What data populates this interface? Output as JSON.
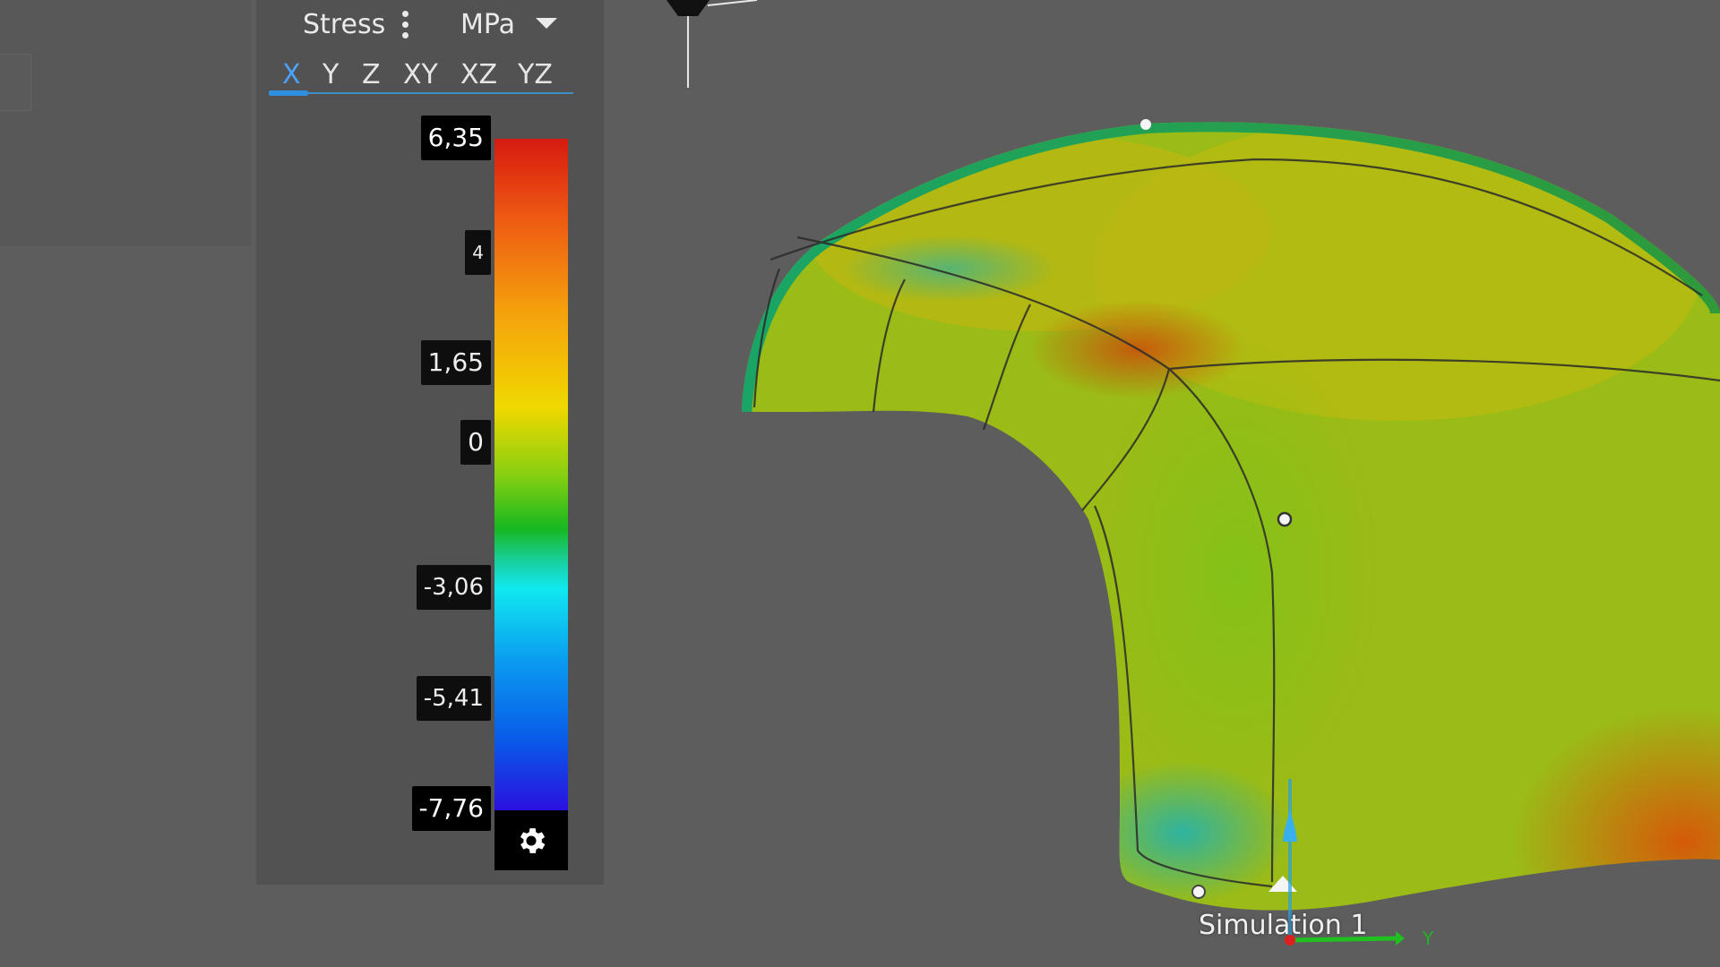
{
  "legend": {
    "result_type": "Stress",
    "unit": "MPa",
    "tabs": [
      {
        "label": "X",
        "active": true
      },
      {
        "label": "Y",
        "active": false
      },
      {
        "label": "Z",
        "active": false
      },
      {
        "label": "XY",
        "active": false
      },
      {
        "label": "XZ",
        "active": false
      },
      {
        "label": "YZ",
        "active": false
      }
    ],
    "ticks": [
      "6,35",
      "4",
      "1,65",
      "0",
      "-3,06",
      "-5,41",
      "-7,76"
    ],
    "max": 6.35,
    "min": -7.76,
    "colors": [
      "#d61a10",
      "#ee5a12",
      "#f5a20c",
      "#f0d800",
      "#88d010",
      "#18b820",
      "#10e8f0",
      "#0a9af0",
      "#0a58e8",
      "#2a10e0"
    ]
  },
  "viewport": {
    "simulation_label": "Simulation 1",
    "axis_y_label": "Y",
    "background": "#5d5d5d"
  },
  "icons": {
    "settings": "gear-icon",
    "more": "more-vertical-icon",
    "dropdown": "caret-down-icon"
  }
}
